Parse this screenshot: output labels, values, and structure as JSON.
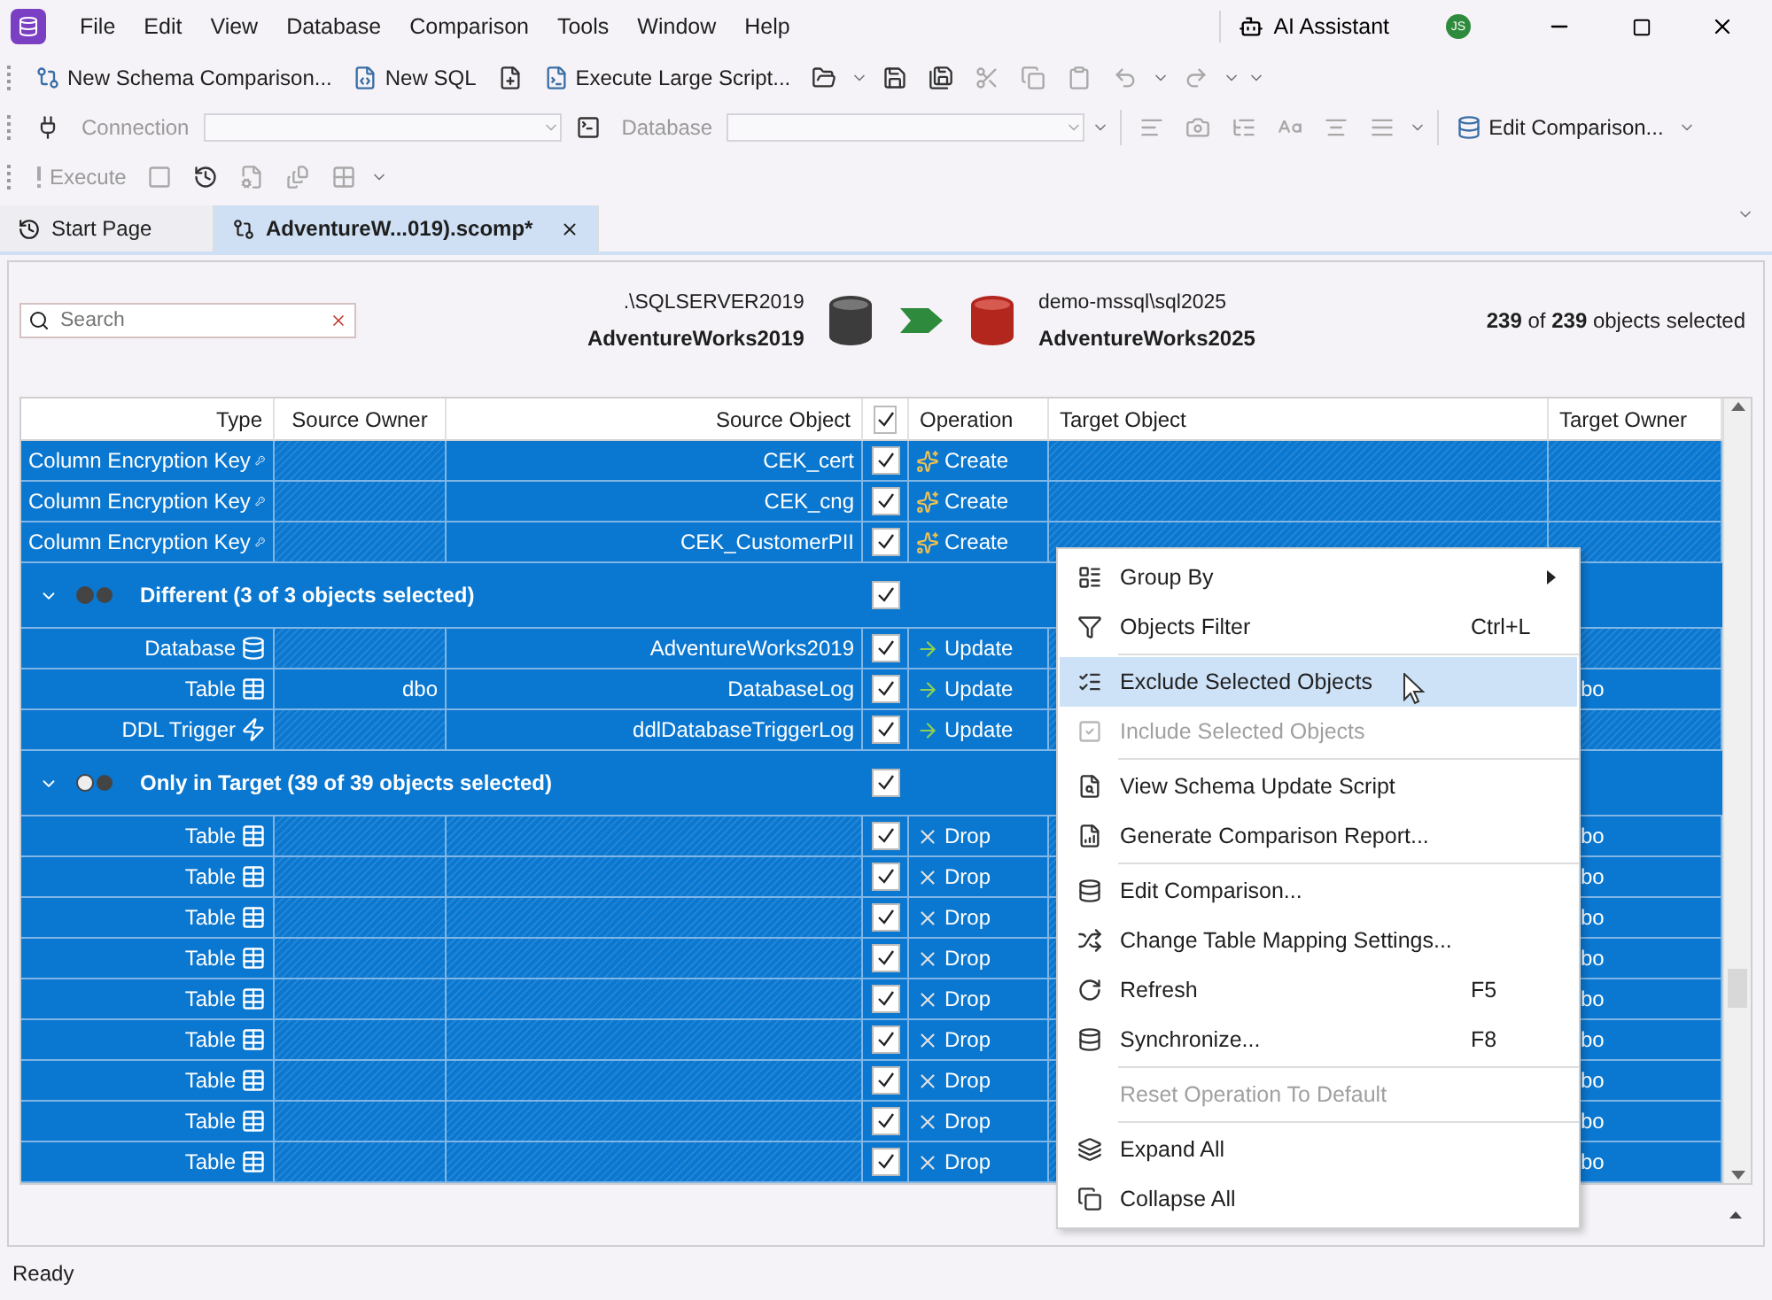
{
  "title_bar": {
    "menus": [
      "File",
      "Edit",
      "View",
      "Database",
      "Comparison",
      "Tools",
      "Window",
      "Help"
    ],
    "assistant": "AI Assistant",
    "avatar": "JS"
  },
  "toolbars": [
    [
      {
        "kind": "button",
        "label": "New Schema Comparison...",
        "disabled": false
      },
      {
        "kind": "button",
        "label": "New SQL",
        "disabled": false
      },
      {
        "kind": "icon",
        "disabled": false
      },
      {
        "kind": "button",
        "label": "Execute Large Script...",
        "disabled": false
      },
      {
        "kind": "icon",
        "disabled": false
      },
      {
        "kind": "caret"
      },
      {
        "kind": "icon",
        "disabled": false
      },
      {
        "kind": "icon",
        "disabled": false
      },
      {
        "kind": "icon",
        "disabled": true
      },
      {
        "kind": "icon",
        "disabled": true
      },
      {
        "kind": "icon",
        "disabled": true
      },
      {
        "kind": "icon",
        "disabled": true
      },
      {
        "kind": "caret"
      },
      {
        "kind": "icon",
        "disabled": true
      },
      {
        "kind": "caret"
      },
      {
        "kind": "caret"
      }
    ],
    [
      {
        "kind": "icon",
        "disabled": false
      },
      {
        "kind": "label",
        "label": "Connection",
        "disabled": true
      },
      {
        "kind": "combo",
        "disabled": true
      },
      {
        "kind": "icon",
        "disabled": false
      },
      {
        "kind": "label",
        "label": "Database",
        "disabled": true
      },
      {
        "kind": "combo",
        "disabled": true
      },
      {
        "kind": "caret"
      },
      {
        "kind": "separator"
      },
      {
        "kind": "icon",
        "disabled": true
      },
      {
        "kind": "icon",
        "disabled": true
      },
      {
        "kind": "icon",
        "disabled": true
      },
      {
        "kind": "icon",
        "disabled": true
      },
      {
        "kind": "icon",
        "disabled": true
      },
      {
        "kind": "icon",
        "disabled": true
      },
      {
        "kind": "caret"
      },
      {
        "kind": "separator"
      },
      {
        "kind": "button",
        "label": "Edit Comparison...",
        "disabled": false
      },
      {
        "kind": "caret"
      }
    ],
    [
      {
        "kind": "button",
        "label": "Execute",
        "disabled": true
      },
      {
        "kind": "icon",
        "disabled": true
      },
      {
        "kind": "icon",
        "disabled": false
      },
      {
        "kind": "icon",
        "disabled": true
      },
      {
        "kind": "icon",
        "disabled": true
      },
      {
        "kind": "icon",
        "disabled": true
      },
      {
        "kind": "caret"
      }
    ]
  ],
  "tabs": [
    {
      "label": "Start Page",
      "selected": false
    },
    {
      "label": "AdventureW...019).scomp*",
      "selected": true
    }
  ],
  "comparison": {
    "search": {
      "placeholder": "Search"
    },
    "source": {
      "server": ".\\SQLSERVER2019",
      "database": "AdventureWorks2019"
    },
    "target": {
      "server": "demo-mssql\\sql2025",
      "database": "AdventureWorks2025"
    },
    "selection": "**239** of **239** objects selected"
  },
  "grid": {
    "columns": [
      "Type",
      "Source Owner",
      "Source Object",
      "",
      "Operation",
      "Target Object",
      "Target Owner"
    ],
    "header_checked": true,
    "items": [
      {
        "kind": "key",
        "type": "Column Encryption Key",
        "source_object": "CEK_cert",
        "checked": true,
        "selected": true,
        "operation": "Create"
      },
      {
        "kind": "key",
        "type": "Column Encryption Key",
        "source_object": "CEK_cng",
        "checked": true,
        "selected": true,
        "operation": "Create"
      },
      {
        "kind": "key",
        "type": "Column Encryption Key",
        "source_object": "CEK_CustomerPII",
        "checked": true,
        "selected": true,
        "operation": "Create"
      },
      {
        "kind": "group-different",
        "label": "Different (3 of 3 objects selected)",
        "expanded": true,
        "checked": true,
        "selected": true,
        "children": [
          {
            "kind": "database",
            "type": "Database",
            "source_object": "AdventureWorks2019",
            "checked": true,
            "selected": true,
            "operation": "Update"
          },
          {
            "kind": "table",
            "type": "Table",
            "source_owner": "dbo",
            "source_object": "DatabaseLog",
            "checked": true,
            "selected": true,
            "operation": "Update",
            "target_owner": "bo"
          },
          {
            "kind": "trigger",
            "type": "DDL Trigger",
            "source_object": "ddlDatabaseTriggerLog",
            "checked": true,
            "selected": true,
            "operation": "Update"
          }
        ]
      },
      {
        "kind": "group-target",
        "label": "Only in Target (39 of 39 objects selected)",
        "expanded": true,
        "checked": true,
        "selected": true,
        "children": [
          {
            "kind": "table",
            "type": "Table",
            "checked": true,
            "selected": true,
            "operation": "Drop",
            "target_owner": "bo"
          },
          {
            "kind": "table",
            "type": "Table",
            "checked": true,
            "selected": true,
            "operation": "Drop",
            "target_owner": "bo"
          },
          {
            "kind": "table",
            "type": "Table",
            "checked": true,
            "selected": true,
            "operation": "Drop",
            "target_owner": "bo"
          },
          {
            "kind": "table",
            "type": "Table",
            "checked": true,
            "selected": true,
            "operation": "Drop",
            "target_owner": "bo"
          },
          {
            "kind": "table",
            "type": "Table",
            "checked": true,
            "selected": true,
            "operation": "Drop",
            "target_owner": "bo"
          },
          {
            "kind": "table",
            "type": "Table",
            "checked": true,
            "selected": true,
            "operation": "Drop",
            "target_owner": "bo"
          },
          {
            "kind": "table",
            "type": "Table",
            "checked": true,
            "selected": true,
            "operation": "Drop",
            "target_owner": "bo"
          },
          {
            "kind": "table",
            "type": "Table",
            "checked": true,
            "selected": true,
            "operation": "Drop",
            "target_owner": "bo"
          },
          {
            "kind": "table",
            "type": "Table",
            "checked": true,
            "selected": true,
            "operation": "Drop",
            "target_owner": "bo"
          }
        ]
      }
    ]
  },
  "context_menu": [
    {
      "kind": "item",
      "label": "Group By",
      "submenu": true,
      "disabled": false,
      "selected": false
    },
    {
      "kind": "item",
      "label": "Objects Filter",
      "shortcut": "Ctrl+L",
      "disabled": false,
      "selected": false
    },
    {
      "kind": "separator"
    },
    {
      "kind": "item",
      "label": "Exclude Selected Objects",
      "disabled": false,
      "selected": true
    },
    {
      "kind": "item",
      "label": "Include Selected Objects",
      "disabled": true,
      "selected": false
    },
    {
      "kind": "separator"
    },
    {
      "kind": "item",
      "label": "View Schema Update Script",
      "disabled": false,
      "selected": false
    },
    {
      "kind": "item",
      "label": "Generate Comparison Report...",
      "disabled": false,
      "selected": false
    },
    {
      "kind": "separator"
    },
    {
      "kind": "item",
      "label": "Edit Comparison...",
      "disabled": false,
      "selected": false
    },
    {
      "kind": "item",
      "label": "Change Table Mapping Settings...",
      "disabled": false,
      "selected": false
    },
    {
      "kind": "item",
      "label": "Refresh",
      "shortcut": "F5",
      "disabled": false,
      "selected": false
    },
    {
      "kind": "item",
      "label": "Synchronize...",
      "shortcut": "F8",
      "disabled": false,
      "selected": false
    },
    {
      "kind": "separator"
    },
    {
      "kind": "item",
      "label": "Reset Operation To Default",
      "disabled": true,
      "selected": false
    },
    {
      "kind": "separator"
    },
    {
      "kind": "item",
      "label": "Expand All",
      "disabled": false,
      "selected": false
    },
    {
      "kind": "item",
      "label": "Collapse All",
      "disabled": false,
      "selected": false
    }
  ],
  "status_bar": "Ready"
}
